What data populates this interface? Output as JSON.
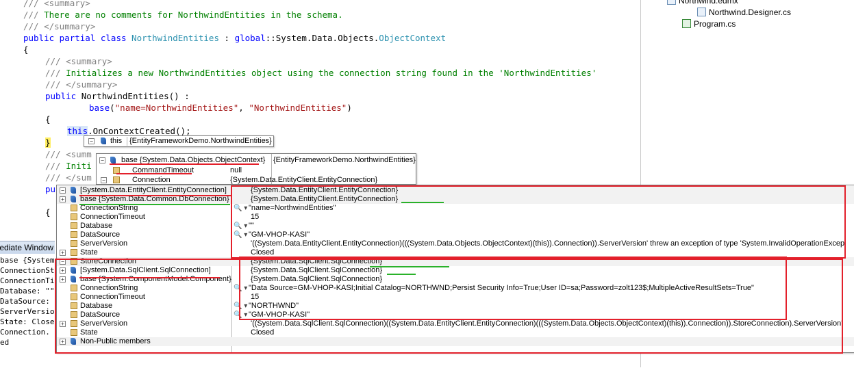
{
  "code": {
    "lines": [
      {
        "indent": 4,
        "parts": [
          {
            "c": "cg",
            "t": "/// <summary>"
          }
        ]
      },
      {
        "indent": 4,
        "parts": [
          {
            "c": "cg",
            "t": "/// "
          },
          {
            "c": "cm",
            "t": "There are no comments for NorthwindEntities in the schema."
          }
        ]
      },
      {
        "indent": 4,
        "parts": [
          {
            "c": "cg",
            "t": "/// </summary>"
          }
        ]
      },
      {
        "indent": 4,
        "parts": [
          {
            "c": "kw",
            "t": "public partial class "
          },
          {
            "c": "ty",
            "t": "NorthwindEntities"
          },
          {
            "c": "tx",
            "t": " : "
          },
          {
            "c": "kw",
            "t": "global"
          },
          {
            "c": "tx",
            "t": "::System.Data.Objects."
          },
          {
            "c": "ty",
            "t": "ObjectContext"
          }
        ]
      },
      {
        "indent": 4,
        "parts": [
          {
            "c": "tx",
            "t": "{"
          }
        ]
      },
      {
        "indent": 8,
        "parts": [
          {
            "c": "cg",
            "t": "/// <summary>"
          }
        ]
      },
      {
        "indent": 8,
        "parts": [
          {
            "c": "cg",
            "t": "/// "
          },
          {
            "c": "cm",
            "t": "Initializes a new NorthwindEntities object using the connection string found in the 'NorthwindEntities'"
          }
        ]
      },
      {
        "indent": 8,
        "parts": [
          {
            "c": "cg",
            "t": "/// </summary>"
          }
        ]
      },
      {
        "indent": 8,
        "parts": [
          {
            "c": "kw",
            "t": "public "
          },
          {
            "c": "tx",
            "t": "NorthwindEntities() :"
          }
        ]
      },
      {
        "indent": 16,
        "parts": [
          {
            "c": "kw",
            "t": "base"
          },
          {
            "c": "tx",
            "t": "("
          },
          {
            "c": "st",
            "t": "\"name=NorthwindEntities\""
          },
          {
            "c": "tx",
            "t": ", "
          },
          {
            "c": "st",
            "t": "\"NorthwindEntities\""
          },
          {
            "c": "tx",
            "t": ")"
          }
        ]
      },
      {
        "indent": 8,
        "parts": [
          {
            "c": "tx",
            "t": "{"
          }
        ]
      },
      {
        "indent": 12,
        "parts": [
          {
            "c": "kw this-hl",
            "t": "this"
          },
          {
            "c": "tx",
            "t": ".OnContextCreated();"
          }
        ]
      },
      {
        "indent": 8,
        "parts": [
          {
            "c": "tx brace-hl",
            "t": "}"
          }
        ]
      },
      {
        "indent": 8,
        "parts": [
          {
            "c": "cg",
            "t": "/// <summ"
          }
        ]
      },
      {
        "indent": 8,
        "parts": [
          {
            "c": "cg",
            "t": "/// "
          },
          {
            "c": "cm",
            "t": "Initi"
          }
        ]
      },
      {
        "indent": 8,
        "parts": [
          {
            "c": "cg",
            "t": "/// </sum"
          }
        ]
      },
      {
        "indent": 8,
        "parts": [
          {
            "c": "kw",
            "t": "pu"
          }
        ]
      },
      {
        "indent": 8,
        "parts": [
          {
            "c": "tx",
            "t": ""
          }
        ]
      },
      {
        "indent": 8,
        "parts": [
          {
            "c": "tx",
            "t": "{"
          }
        ]
      }
    ]
  },
  "solution": {
    "items": [
      {
        "label": "Northwind.edmx",
        "level": 1
      },
      {
        "label": "Northwind.Designer.cs",
        "level": 2
      },
      {
        "label": "Program.cs",
        "level": 1
      }
    ]
  },
  "immediate": {
    "title": "Immediate Window",
    "lines": [
      "base {System.",
      "ConnectionSt",
      "ConnectionTi",
      "Database: \"\"",
      "DataSource: ",
      "ServerVersio",
      "State: Close",
      "Connection.",
      "ed"
    ]
  },
  "datatip_this": {
    "name": "this",
    "value": "{EntityFrameworkDemo.NorthwindEntities}"
  },
  "datatip_base": {
    "rows": [
      {
        "expander": "−",
        "icon": "base",
        "name": "base {System.Data.Objects.ObjectContext}",
        "value": "{EntityFrameworkDemo.NorthwindEntities}"
      },
      {
        "expander": "",
        "icon": "field",
        "name": "CommandTimeout",
        "value": "null"
      },
      {
        "expander": "−",
        "icon": "field",
        "name": "Connection",
        "value": "{System.Data.EntityClient.EntityConnection}"
      }
    ]
  },
  "datatip_main": {
    "rows": [
      {
        "expander": "−",
        "icon": "base",
        "name": "[System.Data.EntityClient.EntityConnection]",
        "mag": "",
        "value": "{System.Data.EntityClient.EntityConnection}",
        "alt": true
      },
      {
        "expander": "+",
        "icon": "base",
        "name": "base {System.Data.Common.DbConnection}",
        "mag": "",
        "value": "{System.Data.EntityClient.EntityConnection}",
        "alt": true
      },
      {
        "expander": "",
        "icon": "field",
        "name": "ConnectionString",
        "mag": "🔍 ▾",
        "value": "\"name=NorthwindEntities\"",
        "alt": false
      },
      {
        "expander": "",
        "icon": "field",
        "name": "ConnectionTimeout",
        "mag": "",
        "value": "15",
        "alt": false
      },
      {
        "expander": "",
        "icon": "field",
        "name": "Database",
        "mag": "🔍 ▾",
        "value": "\"\"",
        "alt": false
      },
      {
        "expander": "",
        "icon": "field",
        "name": "DataSource",
        "mag": "🔍 ▾",
        "value": "\"GM-VHOP-KASI\"",
        "alt": false
      },
      {
        "expander": "",
        "icon": "field",
        "name": "ServerVersion",
        "mag": "",
        "value": "'((System.Data.EntityClient.EntityConnection)(((System.Data.Objects.ObjectContext)(this)).Connection)).ServerVersion' threw an exception of type 'System.InvalidOperationExcep",
        "alt": false
      },
      {
        "expander": "+",
        "icon": "field",
        "name": "State",
        "mag": "",
        "value": "Closed",
        "alt": false
      },
      {
        "expander": "−",
        "icon": "field",
        "name": "StoreConnection",
        "mag": "",
        "value": "{System.Data.SqlClient.SqlConnection}",
        "alt": true
      },
      {
        "expander": "+",
        "icon": "base",
        "name": "[System.Data.SqlClient.SqlConnection]",
        "mag": "",
        "value": "{System.Data.SqlClient.SqlConnection}",
        "alt": false
      },
      {
        "expander": "+",
        "icon": "base",
        "name": "base {System.ComponentModel.Component}",
        "mag": "",
        "value": "{System.Data.SqlClient.SqlConnection}",
        "alt": false
      },
      {
        "expander": "",
        "icon": "field",
        "name": "ConnectionString",
        "mag": "🔍 ▾",
        "value": "\"Data Source=GM-VHOP-KASI;Initial Catalog=NORTHWND;Persist Security Info=True;User ID=sa;Password=zolt123$;MultipleActiveResultSets=True\"",
        "alt": false
      },
      {
        "expander": "",
        "icon": "field",
        "name": "ConnectionTimeout",
        "mag": "",
        "value": "15",
        "alt": false
      },
      {
        "expander": "",
        "icon": "field",
        "name": "Database",
        "mag": "🔍 ▾",
        "value": "\"NORTHWND\"",
        "alt": false
      },
      {
        "expander": "",
        "icon": "field",
        "name": "DataSource",
        "mag": "🔍 ▾",
        "value": "\"GM-VHOP-KASI\"",
        "alt": false
      },
      {
        "expander": "+",
        "icon": "field",
        "name": "ServerVersion",
        "mag": "",
        "value": "'((System.Data.SqlClient.SqlConnection)((System.Data.EntityClient.EntityConnection)(((System.Data.Objects.ObjectContext)(this)).Connection)).StoreConnection).ServerVersion'",
        "alt": false
      },
      {
        "expander": "",
        "icon": "field",
        "name": "State",
        "mag": "",
        "value": "Closed",
        "alt": false
      },
      {
        "expander": "+",
        "icon": "base",
        "name": "Non-Public members",
        "mag": "",
        "value": "",
        "alt": true
      }
    ]
  },
  "colors": {
    "annotation_red": "#e3202b",
    "annotation_green": "#2ab22a"
  }
}
